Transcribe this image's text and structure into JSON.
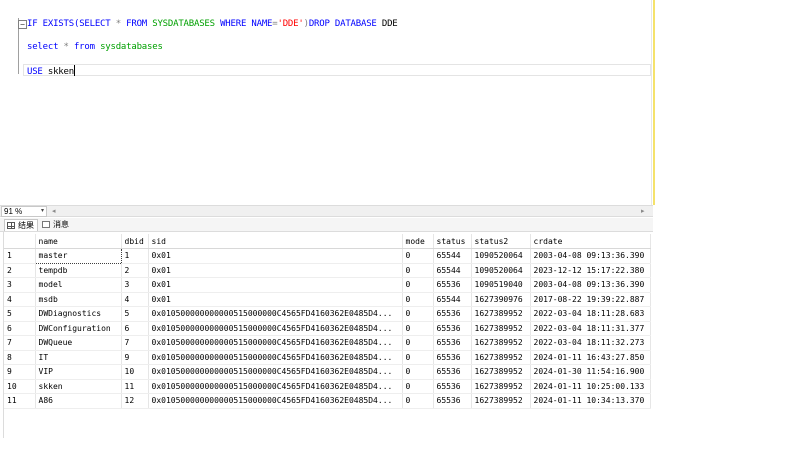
{
  "editor": {
    "collapse_symbol": "−",
    "line1": [
      {
        "t": "IF EXISTS(",
        "c": "kw"
      },
      {
        "t": "SELECT ",
        "c": "kw"
      },
      {
        "t": "* ",
        "c": "op"
      },
      {
        "t": "FROM ",
        "c": "kw"
      },
      {
        "t": "SYSDATABASES ",
        "c": "obj"
      },
      {
        "t": "WHERE ",
        "c": "kw"
      },
      {
        "t": "NAME",
        "c": "kw"
      },
      {
        "t": "=",
        "c": "op"
      },
      {
        "t": "'DDE'",
        "c": "str"
      },
      {
        "t": ")",
        "c": "op"
      },
      {
        "t": "DROP DATABASE ",
        "c": "kw"
      },
      {
        "t": "DDE",
        "c": "plain"
      }
    ],
    "line2": [
      {
        "t": "select ",
        "c": "kw"
      },
      {
        "t": "* ",
        "c": "op"
      },
      {
        "t": "from ",
        "c": "kw"
      },
      {
        "t": "sysdatabases",
        "c": "obj"
      }
    ],
    "line3": [
      {
        "t": "USE ",
        "c": "kw"
      },
      {
        "t": "skken",
        "c": "plain"
      }
    ]
  },
  "zoom": {
    "value": "91 %",
    "arrow": "▾"
  },
  "scroll": {
    "left": "◂",
    "right": "▸"
  },
  "tabs": {
    "results": "结果",
    "messages": "消息"
  },
  "results": {
    "columns": [
      "name",
      "dbid",
      "sid",
      "mode",
      "status",
      "status2",
      "crdate"
    ],
    "rows": [
      [
        "1",
        "master",
        "1",
        "0x01",
        "0",
        "65544",
        "1090520064",
        "2003-04-08 09:13:36.390"
      ],
      [
        "2",
        "tempdb",
        "2",
        "0x01",
        "0",
        "65544",
        "1090520064",
        "2023-12-12 15:17:22.380"
      ],
      [
        "3",
        "model",
        "3",
        "0x01",
        "0",
        "65536",
        "1090519040",
        "2003-04-08 09:13:36.390"
      ],
      [
        "4",
        "msdb",
        "4",
        "0x01",
        "0",
        "65544",
        "1627390976",
        "2017-08-22 19:39:22.887"
      ],
      [
        "5",
        "DWDiagnostics",
        "5",
        "0x010500000000000515000000C4565FD4160362E0485D4...",
        "0",
        "65536",
        "1627389952",
        "2022-03-04 18:11:28.683"
      ],
      [
        "6",
        "DWConfiguration",
        "6",
        "0x010500000000000515000000C4565FD4160362E0485D4...",
        "0",
        "65536",
        "1627389952",
        "2022-03-04 18:11:31.377"
      ],
      [
        "7",
        "DWQueue",
        "7",
        "0x010500000000000515000000C4565FD4160362E0485D4...",
        "0",
        "65536",
        "1627389952",
        "2022-03-04 18:11:32.273"
      ],
      [
        "8",
        "IT",
        "9",
        "0x010500000000000515000000C4565FD4160362E0485D4...",
        "0",
        "65536",
        "1627389952",
        "2024-01-11 16:43:27.850"
      ],
      [
        "9",
        "VIP",
        "10",
        "0x010500000000000515000000C4565FD4160362E0485D4...",
        "0",
        "65536",
        "1627389952",
        "2024-01-30 11:54:16.900"
      ],
      [
        "10",
        "skken",
        "11",
        "0x010500000000000515000000C4565FD4160362E0485D4...",
        "0",
        "65536",
        "1627389952",
        "2024-01-11 10:25:00.133"
      ],
      [
        "11",
        "A86",
        "12",
        "0x010500000000000515000000C4565FD4160362E0485D4...",
        "0",
        "65536",
        "1627389952",
        "2024-01-11 10:34:13.370"
      ]
    ]
  }
}
